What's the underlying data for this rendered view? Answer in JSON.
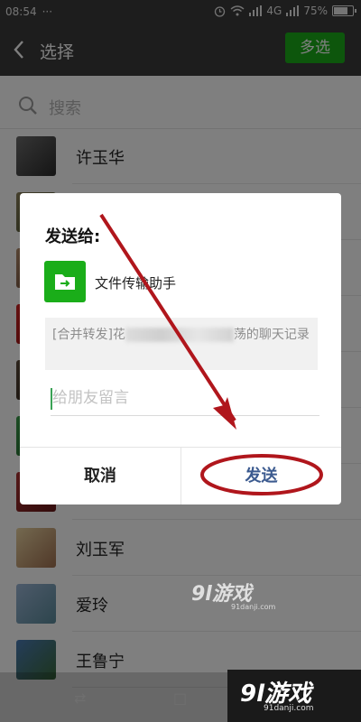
{
  "status_bar": {
    "time": "08:54",
    "notification_dots": "···",
    "network": "4G",
    "battery": "75%",
    "battery_level": 0.75
  },
  "header": {
    "title": "选择",
    "multi_select_label": "多选",
    "accent_color": "#1aad19"
  },
  "search": {
    "placeholder": "搜索"
  },
  "contacts": [
    {
      "name": "许玉华",
      "avatar_colors": [
        "#6b6b6b",
        "#2a2a2a"
      ]
    },
    {
      "name": "刘玉军",
      "avatar_colors": [
        "#8a7f5a",
        "#3f4a2a"
      ]
    },
    {
      "name": "",
      "avatar_colors": [
        "#b08a6a",
        "#5a3a2a"
      ]
    },
    {
      "name": "",
      "avatar_colors": [
        "#cc2222",
        "#881111"
      ]
    },
    {
      "name": "",
      "avatar_colors": [
        "#5a4a3a",
        "#2a2018"
      ]
    },
    {
      "name": "",
      "avatar_colors": [
        "#3a9a4a",
        "#1e5a28"
      ]
    },
    {
      "name": "",
      "avatar_colors": [
        "#aa3333",
        "#661818"
      ]
    },
    {
      "name": "刘玉军",
      "avatar_colors": [
        "#e8d2a0",
        "#a07050"
      ]
    },
    {
      "name": "爱玲",
      "avatar_colors": [
        "#9ab4d4",
        "#5a8a9a"
      ]
    },
    {
      "name": "王鲁宁",
      "avatar_colors": [
        "#4a7ab4",
        "#3a6a3a"
      ]
    }
  ],
  "dialog": {
    "title": "发送给:",
    "recipient_name": "文件传输助手",
    "recipient_icon": "folder-arrow-icon",
    "preview_prefix": "[合并转发]花",
    "preview_suffix": "荡的聊天记录",
    "message_placeholder": "给朋友留言",
    "cancel_label": "取消",
    "send_label": "发送",
    "send_color": "#3b5a8f"
  },
  "annotation": {
    "color": "#b0161c",
    "shapes": [
      "arrow",
      "ellipse"
    ]
  },
  "bottom_nav": {
    "back_icon": "⇄",
    "home_icon": "□"
  },
  "watermarks": {
    "mid_logo": "9l游戏",
    "mid_url": "91danji.com",
    "corner_logo": "9l游戏",
    "corner_url": "91danji.com"
  }
}
